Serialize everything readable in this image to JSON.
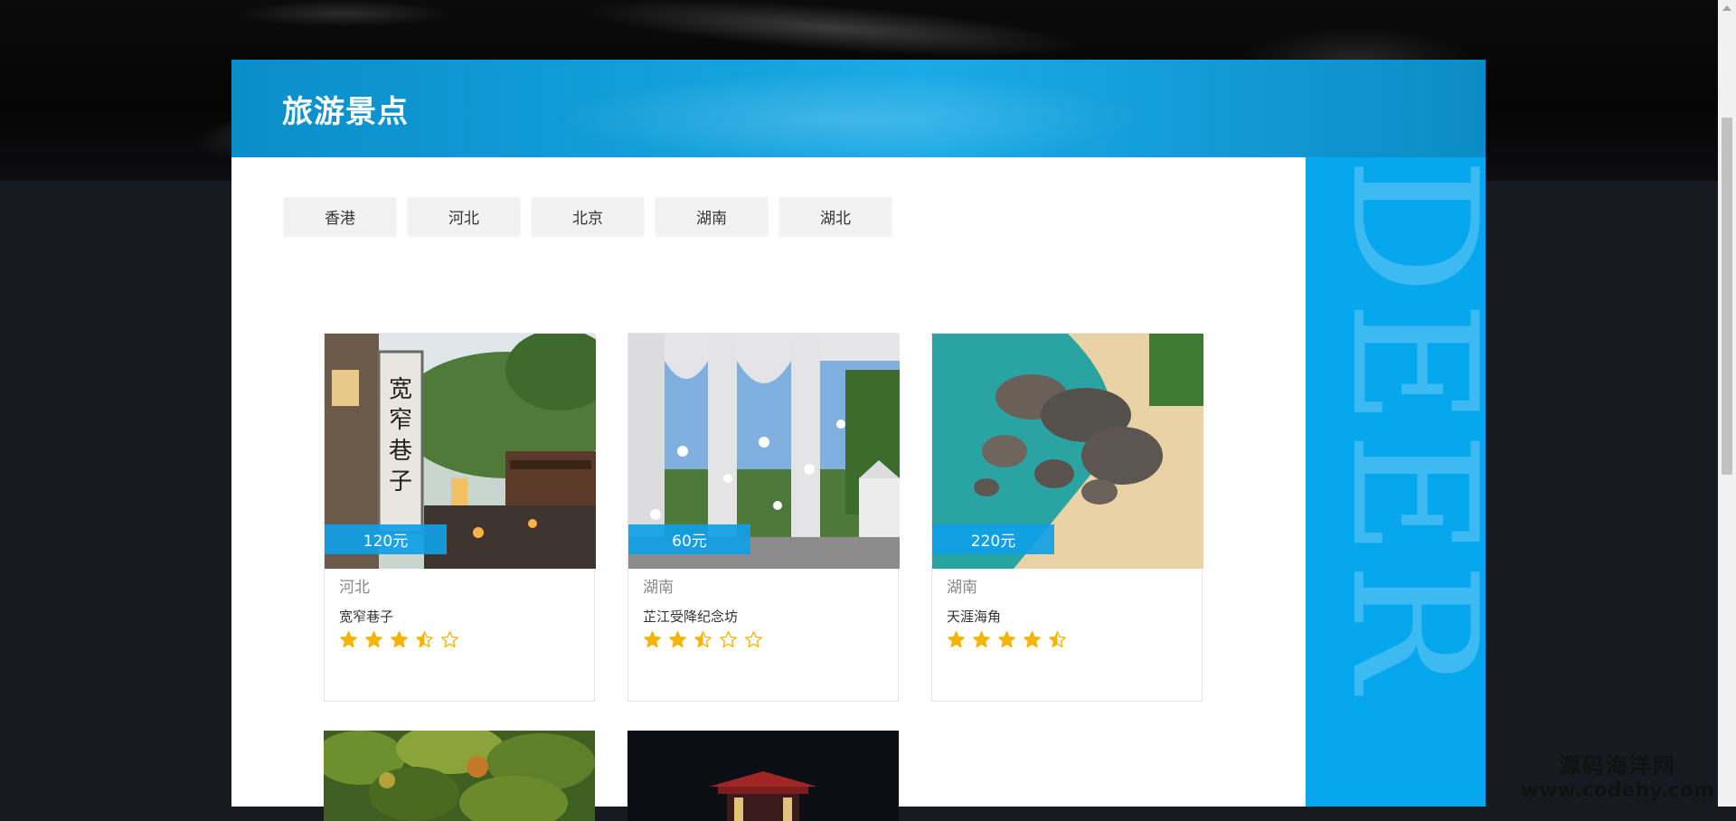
{
  "header": {
    "title": "旅游景点"
  },
  "tabs": [
    {
      "label": "香港"
    },
    {
      "label": "河北"
    },
    {
      "label": "北京"
    },
    {
      "label": "湖南"
    },
    {
      "label": "湖北"
    }
  ],
  "side_decoration": {
    "text": "DEER"
  },
  "cards": [
    {
      "price": "120元",
      "region": "河北",
      "name": "宽窄巷子",
      "rating": 3.5,
      "image": "alley-with-stone-sign"
    },
    {
      "price": "60元",
      "region": "湖南",
      "name": "芷江受降纪念坊",
      "rating": 2.5,
      "image": "memorial-arch-with-doves"
    },
    {
      "price": "220元",
      "region": "湖南",
      "name": "天涯海角",
      "rating": 4.5,
      "image": "rocky-beach-coast"
    }
  ],
  "partial_cards": [
    {
      "image": "forest-trees"
    },
    {
      "image": "night-pavilion"
    }
  ],
  "watermark": {
    "line1": "源码海洋网",
    "line2": "www.codehy.com"
  },
  "colors": {
    "accent": "#0fa0e6",
    "header_blue": "#0a8ec9",
    "side_blue": "#07a7ee",
    "star": "#f5b400",
    "page_bg": "#171a21"
  }
}
